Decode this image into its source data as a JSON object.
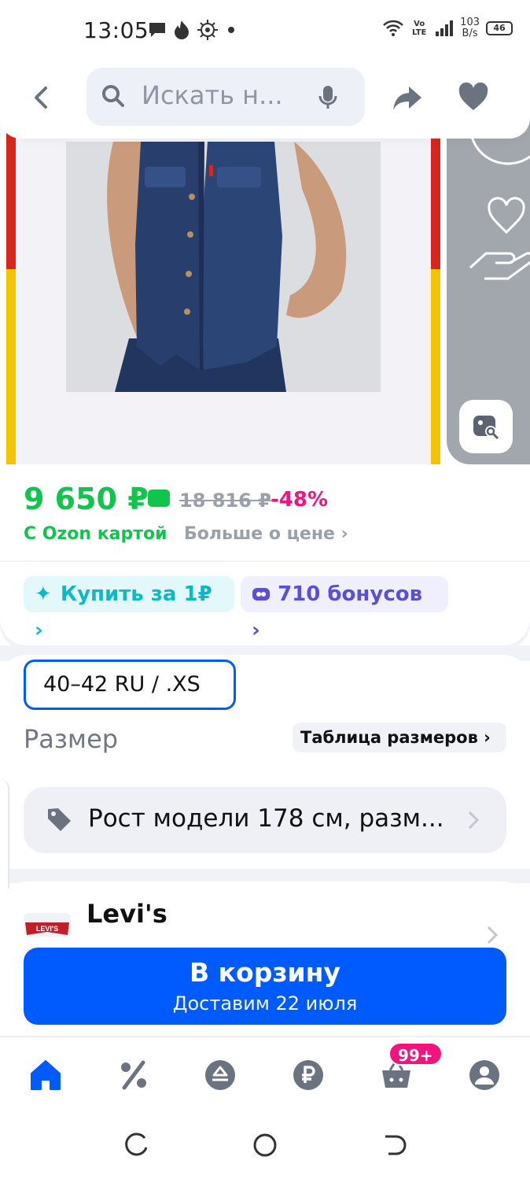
{
  "status_bar": {
    "time": "13:05",
    "speed_value": "103",
    "speed_unit": "B/s",
    "network": "Vo LTE",
    "battery": "46"
  },
  "header": {
    "search_placeholder": "Искать н...",
    "icons": [
      "back-icon",
      "search-icon",
      "mic-icon",
      "share-icon",
      "heart-icon"
    ]
  },
  "price": {
    "current": "9 650 ₽",
    "old": "18 816 ₽",
    "discount": "-48%",
    "card_note": "С Ozon картой",
    "more_link": "Больше о цене ›"
  },
  "chips": {
    "buy_label": "Купить за 1₽ ›",
    "bonus_label": "710 бонусов ›"
  },
  "size": {
    "selected": "40–42 RU / .XS",
    "label": "Размер",
    "table_link": "Таблица размеров ›"
  },
  "model_info": "Рост модели 178 см, разм...",
  "brand": {
    "name": "Levi's",
    "logo_text": "LEVI'S"
  },
  "cart_button": {
    "title": "В корзину",
    "subtitle": "Доставим 22 июля"
  },
  "bottom_nav": {
    "cart_badge": "99+",
    "items": [
      "home-icon",
      "discount-icon",
      "brands-icon",
      "finance-icon",
      "cart-icon",
      "profile-icon"
    ]
  },
  "colors": {
    "brand_blue": "#005bff",
    "price_green": "#10c44c",
    "discount_pink": "#f2137c",
    "frame_red": "#d9251c",
    "frame_yellow": "#f5c300"
  }
}
